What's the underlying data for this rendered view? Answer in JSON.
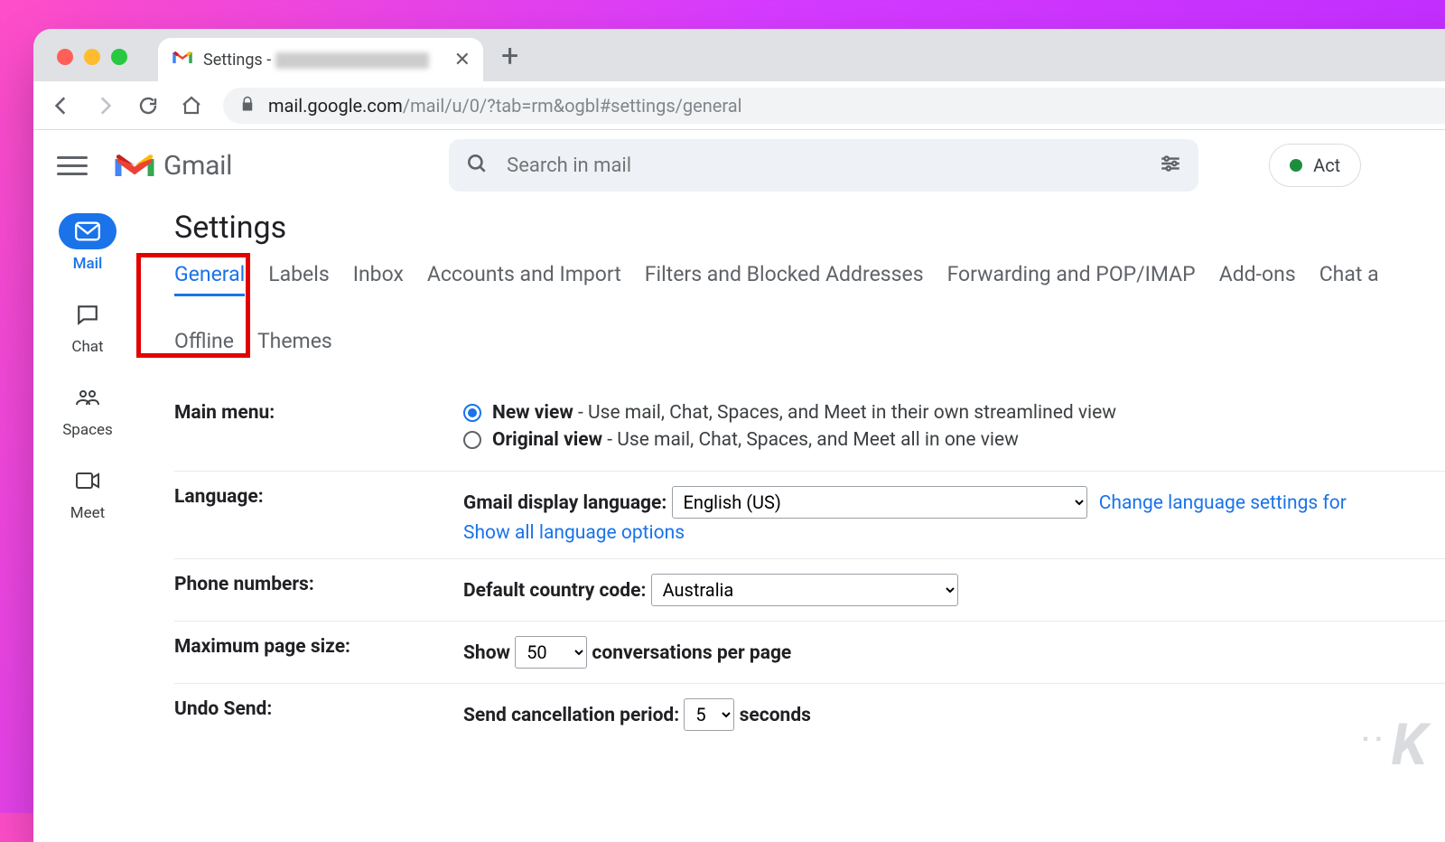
{
  "browser": {
    "tab_title_prefix": "Settings - ",
    "url_host": "mail.google.com",
    "url_path": "/mail/u/0/?tab=rm&ogbl#settings/general"
  },
  "header": {
    "product": "Gmail",
    "search_placeholder": "Search in mail",
    "status_label": "Act"
  },
  "rail": {
    "items": [
      {
        "label": "Mail"
      },
      {
        "label": "Chat"
      },
      {
        "label": "Spaces"
      },
      {
        "label": "Meet"
      }
    ]
  },
  "page_title": "Settings",
  "tabs": {
    "row1": [
      "General",
      "Labels",
      "Inbox",
      "Accounts and Import",
      "Filters and Blocked Addresses",
      "Forwarding and POP/IMAP",
      "Add-ons",
      "Chat a"
    ],
    "row2": [
      "Offline",
      "Themes"
    ]
  },
  "settings": {
    "main_menu": {
      "label": "Main menu:",
      "opt1_bold": "New view",
      "opt1_desc": " - Use mail, Chat, Spaces, and Meet in their own streamlined view",
      "opt2_bold": "Original view",
      "opt2_desc": " - Use mail, Chat, Spaces, and Meet all in one view"
    },
    "language": {
      "label": "Language:",
      "display_label": "Gmail display language: ",
      "display_value": "English (US)",
      "change_link": "Change language settings for",
      "show_all": "Show all language options"
    },
    "phone": {
      "label": "Phone numbers:",
      "cc_label": "Default country code: ",
      "cc_value": "Australia"
    },
    "page_size": {
      "label": "Maximum page size:",
      "show": "Show ",
      "value": "50",
      "after": " conversations per page"
    },
    "undo": {
      "label": "Undo Send:",
      "before": "Send cancellation period: ",
      "value": "5",
      "after": " seconds"
    }
  }
}
